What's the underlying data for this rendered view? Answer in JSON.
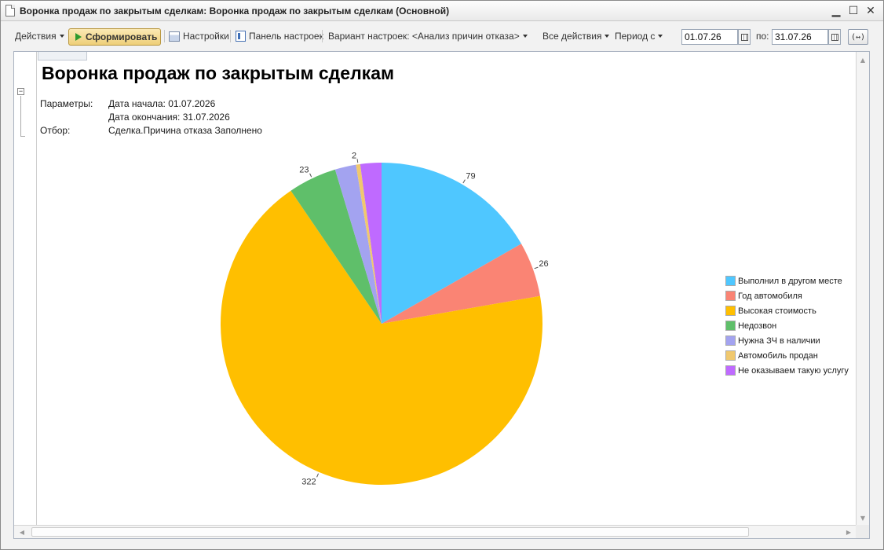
{
  "window": {
    "title": "Воронка продаж по закрытым сделкам: Воронка продаж по закрытым сделкам (Основной)",
    "minimize": "▁",
    "maximize": "☐",
    "close": "✕"
  },
  "toolbar": {
    "actions_label": "Действия",
    "generate_label": "Сформировать",
    "settings_label": "Настройки",
    "panel_label": "Панель настроек",
    "variant_label": "Вариант настроек: <Анализ причин отказа>",
    "all_actions_label": "Все действия",
    "period_label": "Период с",
    "date_from": "01.07.26",
    "to_label": "по:",
    "date_to": "31.07.26",
    "period_button": "(↔)"
  },
  "report": {
    "title": "Воронка продаж по закрытым сделкам",
    "params_label": "Параметры:",
    "start_date": "Дата начала: 01.07.2026",
    "end_date": "Дата окончания: 31.07.2026",
    "filter_label": "Отбор:",
    "filter_value": "Сделка.Причина отказа Заполнено"
  },
  "chart_data": {
    "type": "pie",
    "categories": [
      "Выполнил в другом месте",
      "Год автомобиля",
      "Высокая стоимость",
      "Недозвон",
      "Нужна ЗЧ в наличии",
      "Автомобиль продан",
      "Не оказываем такую услугу"
    ],
    "values": [
      79,
      26,
      322,
      23,
      10,
      2,
      10
    ],
    "data_labels": [
      "79",
      "26",
      "322",
      "23",
      "",
      "2",
      ""
    ],
    "colors": [
      "#4fc7ff",
      "#fa8474",
      "#ffbf00",
      "#5fbf6a",
      "#a3a3f0",
      "#f0c86e",
      "#bf6aff"
    ],
    "start_angle": "12 o'clock",
    "direction": "clockwise",
    "legend_position": "right"
  }
}
